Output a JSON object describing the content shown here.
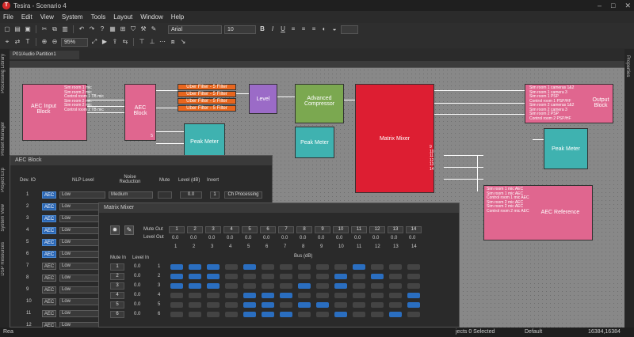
{
  "app": {
    "title": "Tesira - Scenario 4",
    "logo": "T"
  },
  "menu": [
    "File",
    "Edit",
    "View",
    "System",
    "Tools",
    "Layout",
    "Window",
    "Help"
  ],
  "toolbar": {
    "zoom": "95%",
    "font": "Arial",
    "font_size": "10",
    "bold": "B",
    "italic": "I",
    "underline": "U"
  },
  "siderail_left": [
    "Processing Library",
    "Preset Manager",
    "Project Exp",
    "System View",
    "DSP Resources"
  ],
  "siderail_right": [
    "Properties"
  ],
  "doc_tab": "P01/Audio Partition1",
  "blocks": {
    "aec_input": {
      "label": "AEC Input Block",
      "pins": [
        "Sim room 1 mic",
        "Sim room 2 mic",
        "Control room 1 TB mic",
        "Sim room 2 mic",
        "Sim room 2 mic",
        "Control room 2 TB mic"
      ]
    },
    "aec": {
      "label": "AEC Block",
      "pin_num": "5"
    },
    "uber1": "Uber Filter - 5 Filter",
    "uber2": "Uber Filter - 5 Filter",
    "uber3": "Uber Filter - 5 Filter",
    "uber4": "Uber Filter - 5 Filter",
    "level": "Level",
    "compressor": "Advanced Compressor",
    "peak1": "Peak Meter",
    "peak2": "Peak Meter",
    "peak3": "Peak Meter",
    "matrix": "Matrix Mixer",
    "matrix_pins": [
      "9",
      "10",
      "11",
      "12",
      "13",
      "14"
    ],
    "output": {
      "label": "Output Block",
      "pins": [
        "Sim room 1 cameras 1&2",
        "Sim room 1 camera 3",
        "Sim room 1 PSP",
        "Control room 1 PSP/HF",
        "Sim room 2 cameras 1&2",
        "Sim room 2 camera 3",
        "Sim room 2 PSP",
        "Control room 2 PSP/HF"
      ]
    },
    "aec_ref": {
      "label": "AEC Reference",
      "pins": [
        "Sim room 1 mic AEC",
        "Sim room 1 mic AEC",
        "Control room 1 mic AEC",
        "Sim room 2 mic AEC",
        "Sim room 2 mic AEC",
        "Control room 2 mic AEC"
      ]
    }
  },
  "aec_panel": {
    "title": "AEC Block",
    "headers": {
      "dev": "Dev. IO",
      "nlp": "NLP Level",
      "noise": "Noise Reduction",
      "mute": "Mute",
      "level": "Level (dB)",
      "invert": "Invert"
    },
    "rows": [
      {
        "n": "1",
        "btn": "AEC",
        "nlp": "Low",
        "noise": "Medium",
        "level": "0.0",
        "inv": "1",
        "extra": "Ch Processing",
        "on": true
      },
      {
        "n": "2",
        "btn": "AEC",
        "nlp": "Low",
        "on": true
      },
      {
        "n": "3",
        "btn": "AEC",
        "nlp": "Low",
        "on": true
      },
      {
        "n": "4",
        "btn": "AEC",
        "nlp": "Low",
        "on": true
      },
      {
        "n": "5",
        "btn": "AEC",
        "nlp": "Low",
        "on": true
      },
      {
        "n": "6",
        "btn": "AEC",
        "nlp": "Low",
        "on": true
      },
      {
        "n": "7",
        "btn": "AEC",
        "nlp": "Low",
        "on": false
      },
      {
        "n": "8",
        "btn": "AEC",
        "nlp": "Low",
        "on": false
      },
      {
        "n": "9",
        "btn": "AEC",
        "nlp": "Low",
        "on": false
      },
      {
        "n": "10",
        "btn": "AEC",
        "nlp": "Low",
        "on": false
      },
      {
        "n": "11",
        "btn": "AEC",
        "nlp": "Low",
        "on": false
      },
      {
        "n": "12",
        "btn": "AEC",
        "nlp": "Low",
        "on": false
      }
    ]
  },
  "matrix_panel": {
    "title": "Matrix Mixer",
    "mute_out": "Mute Out",
    "level_out": "Level Out",
    "mute_in": "Mute In",
    "level_in": "Level In",
    "bus_label": "Bus (dB)",
    "out_cols": [
      "1",
      "2",
      "3",
      "4",
      "5",
      "6",
      "7",
      "8",
      "9",
      "10",
      "11",
      "12",
      "13",
      "14"
    ],
    "out_level": "0.0",
    "in_rows": [
      {
        "n": "1",
        "lvl": "0.0",
        "idx": "1",
        "on": [
          1,
          1,
          1,
          0,
          1,
          0,
          0,
          0,
          0,
          0,
          1,
          0,
          0,
          0
        ]
      },
      {
        "n": "2",
        "lvl": "0.0",
        "idx": "2",
        "on": [
          1,
          1,
          1,
          0,
          0,
          0,
          0,
          0,
          0,
          1,
          0,
          1,
          0,
          0
        ]
      },
      {
        "n": "3",
        "lvl": "0.0",
        "idx": "3",
        "on": [
          1,
          1,
          1,
          0,
          0,
          0,
          0,
          1,
          0,
          1,
          0,
          0,
          0,
          0
        ]
      },
      {
        "n": "4",
        "lvl": "0.0",
        "idx": "4",
        "on": [
          0,
          0,
          0,
          0,
          1,
          1,
          1,
          0,
          0,
          0,
          0,
          0,
          0,
          1
        ]
      },
      {
        "n": "5",
        "lvl": "0.0",
        "idx": "5",
        "on": [
          0,
          0,
          0,
          0,
          1,
          1,
          0,
          1,
          1,
          0,
          0,
          0,
          0,
          1
        ]
      },
      {
        "n": "6",
        "lvl": "0.0",
        "idx": "6",
        "on": [
          0,
          0,
          0,
          0,
          1,
          1,
          1,
          0,
          0,
          1,
          0,
          0,
          1,
          0
        ]
      }
    ]
  },
  "status": {
    "left": "Rea",
    "selected": "jects   0 Selected",
    "default": "Default",
    "coords": "16384,16384"
  }
}
